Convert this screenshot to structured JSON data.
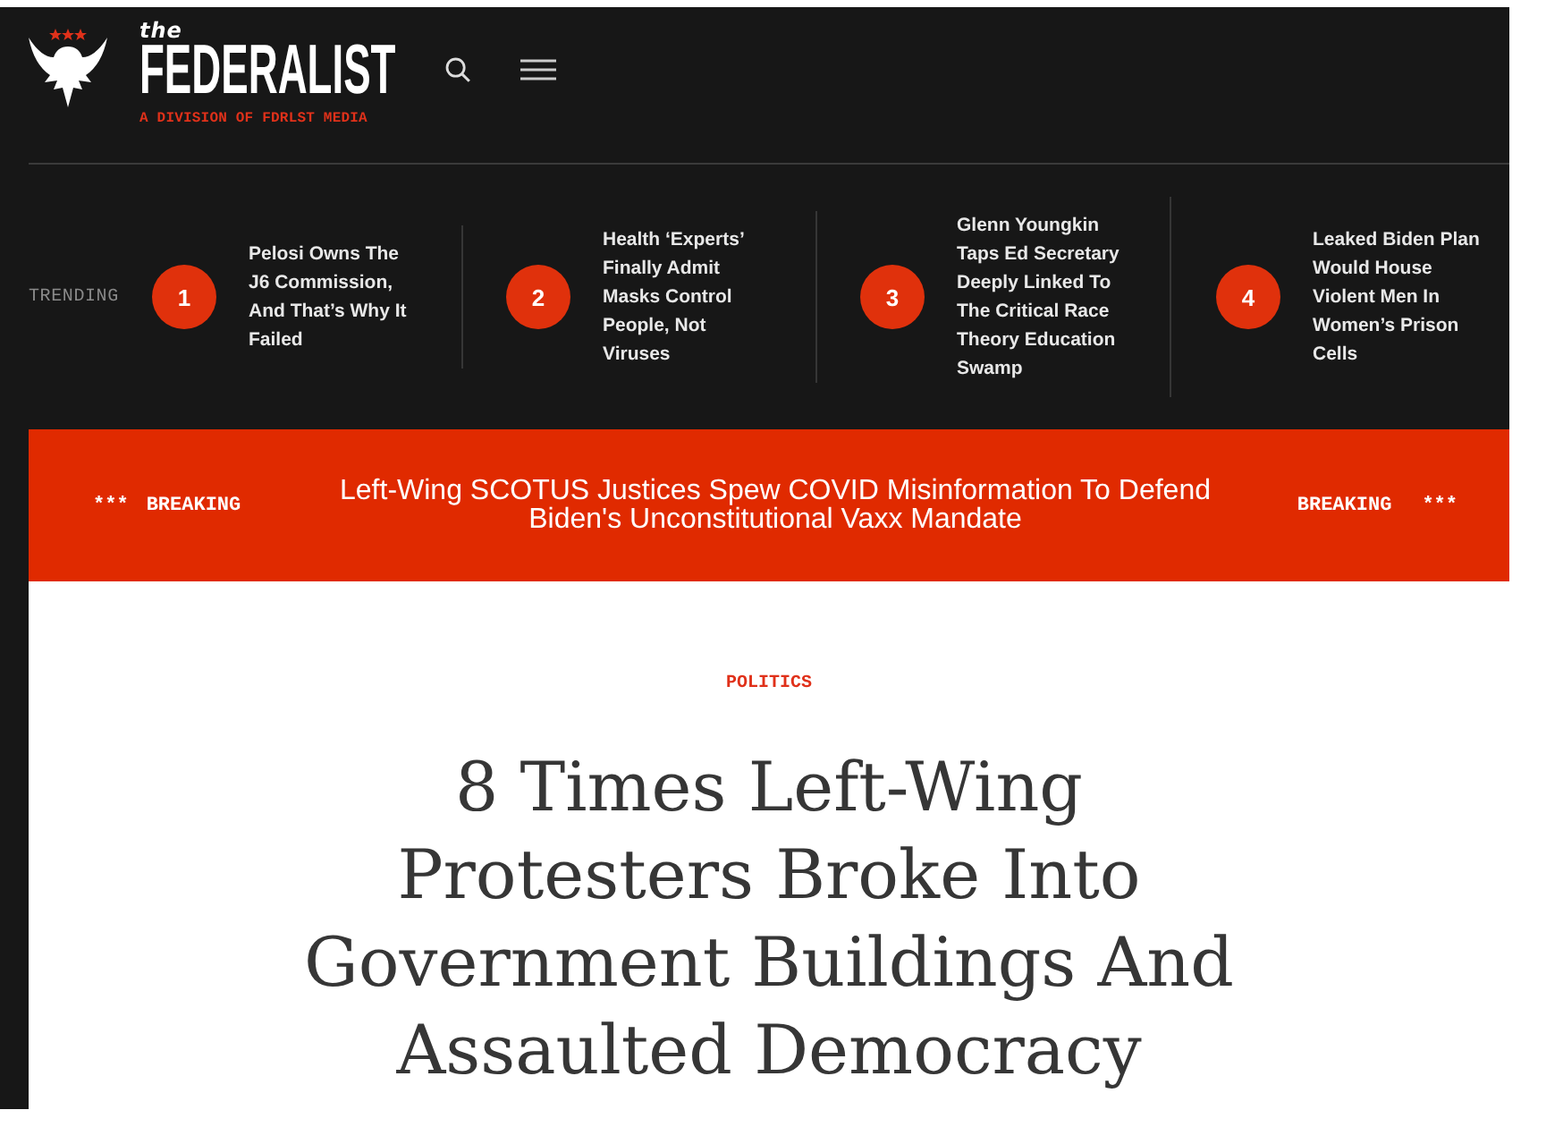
{
  "header": {
    "brand_prefix": "the",
    "brand_name": "FEDERALIST",
    "tagline": "A DIVISION OF FDRLST MEDIA"
  },
  "trending": {
    "label": "TRENDING",
    "items": [
      {
        "rank": "1",
        "title": "Pelosi Owns The J6 Commission, And That’s Why It Failed"
      },
      {
        "rank": "2",
        "title": "Health ‘Experts’ Finally Admit Masks Control People, Not Viruses"
      },
      {
        "rank": "3",
        "title": "Glenn Youngkin Taps Ed Secretary Deeply Linked To The Critical Race Theory Education Swamp"
      },
      {
        "rank": "4",
        "title": "Leaked Biden Plan Would House Violent Men In Women’s Prison Cells"
      }
    ]
  },
  "breaking": {
    "lead_mark": "***",
    "lead_label": "BREAKING",
    "headline": "Left-Wing SCOTUS Justices Spew COVID Misinformation To Defend Biden's Unconstitutional Vaxx Mandate",
    "tail_label": "BREAKING",
    "tail_mark": "***"
  },
  "article": {
    "category": "POLITICS",
    "title": "8 Times Left-Wing Protesters Broke Into Government Buildings And Assaulted Democracy"
  }
}
